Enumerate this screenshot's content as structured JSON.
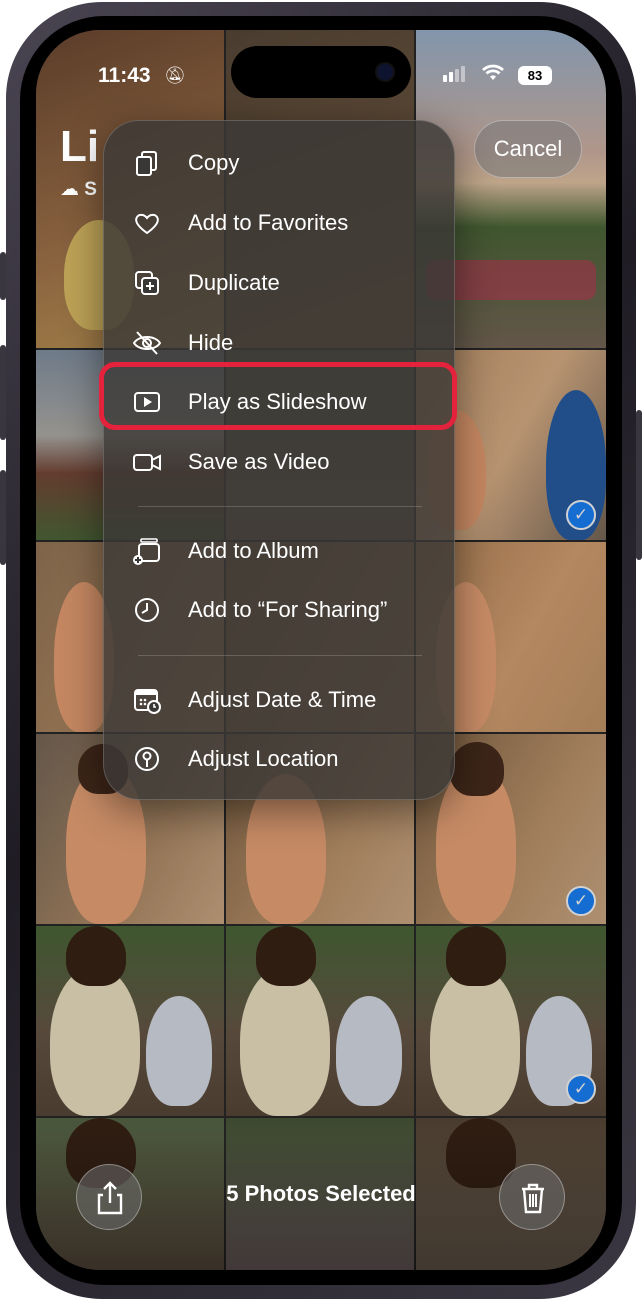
{
  "status_bar": {
    "time": "11:43",
    "battery": "83"
  },
  "header": {
    "title_partial": "Li",
    "subtitle_partial": "S",
    "cancel_label": "Cancel"
  },
  "menu": {
    "items": [
      {
        "label": "Copy",
        "icon": "copy-icon"
      },
      {
        "label": "Add to Favorites",
        "icon": "heart-icon"
      },
      {
        "label": "Duplicate",
        "icon": "duplicate-icon"
      },
      {
        "label": "Hide",
        "icon": "eye-slash-icon"
      },
      {
        "label": "Play as Slideshow",
        "icon": "play-rectangle-icon",
        "highlighted": true
      },
      {
        "label": "Save as Video",
        "icon": "video-icon"
      },
      {
        "label": "Add to Album",
        "icon": "add-album-icon"
      },
      {
        "label": "Add to “For Sharing”",
        "icon": "clock-icon"
      },
      {
        "label": "Adjust Date & Time",
        "icon": "calendar-clock-icon"
      },
      {
        "label": "Adjust Location",
        "icon": "location-info-icon"
      }
    ]
  },
  "toolbar": {
    "selection_text": "5 Photos Selected"
  },
  "colors": {
    "highlight": "#e4223b",
    "check": "#1a84ff"
  }
}
